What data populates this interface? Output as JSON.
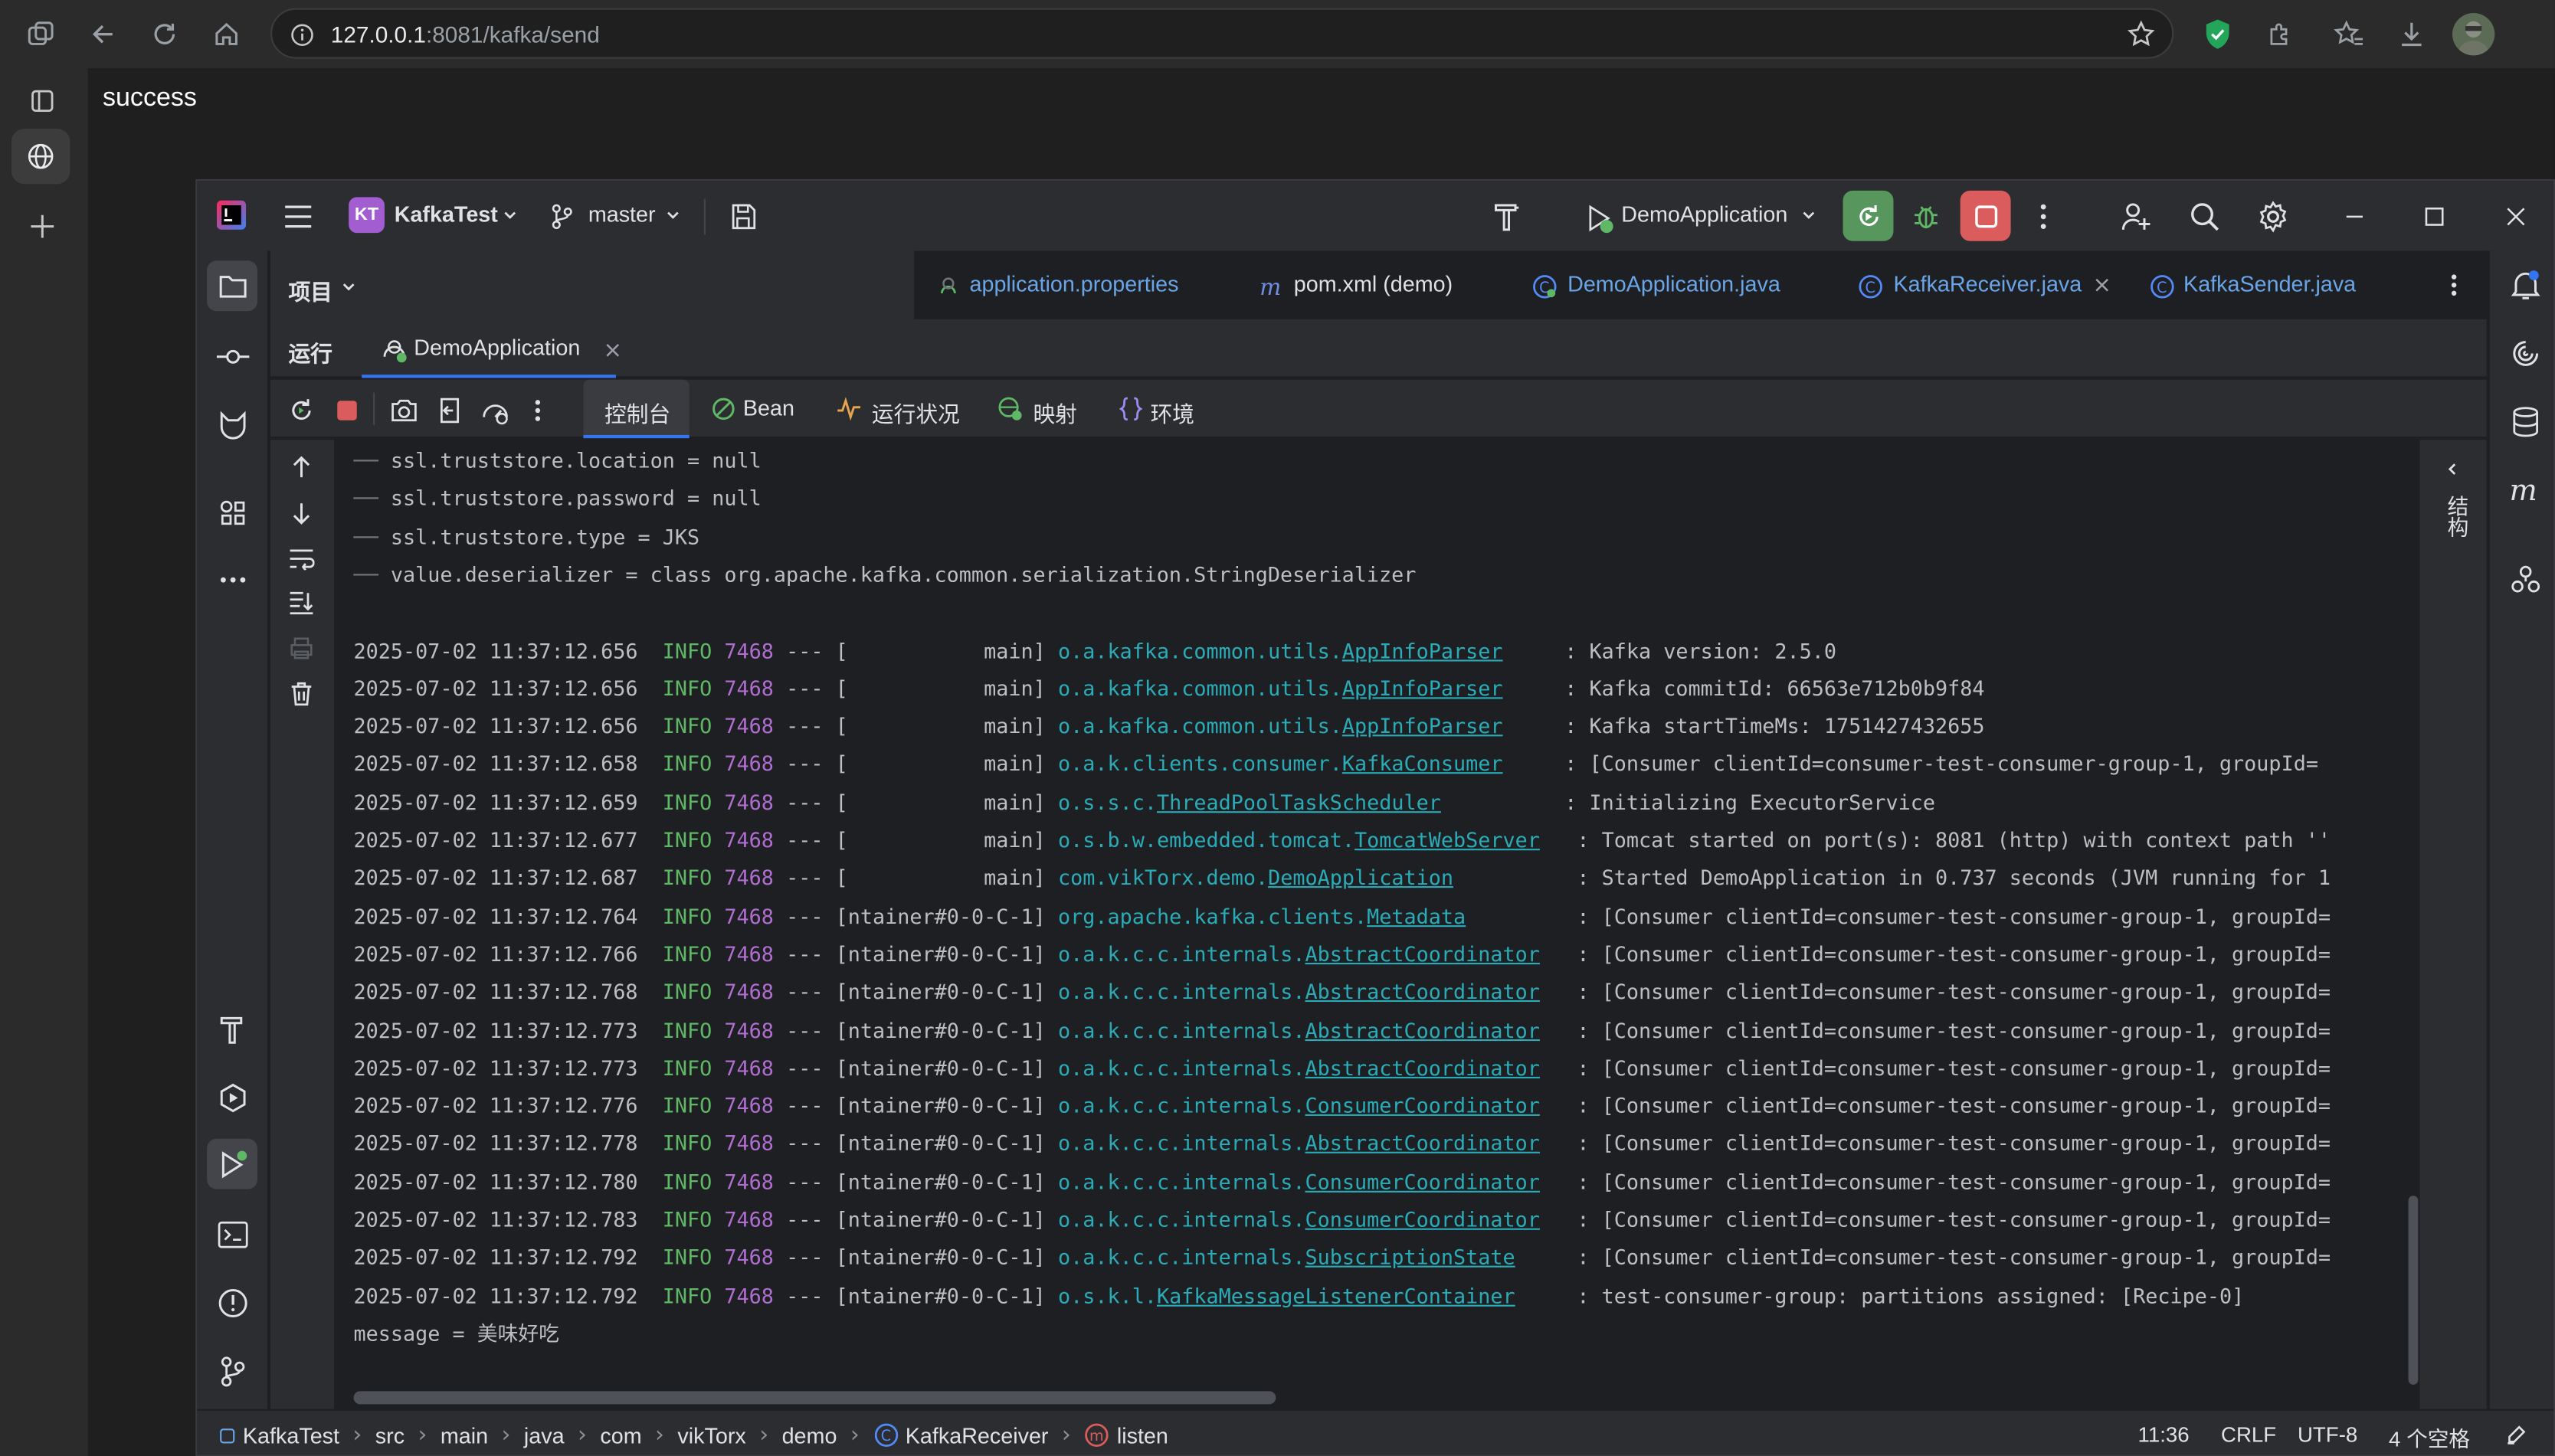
{
  "browser": {
    "url_host": "127.0.0.1",
    "url_path": ":8081/kafka/send",
    "page_text": "success"
  },
  "ide": {
    "project_badge": "KT",
    "project_name": "KafkaTest",
    "branch": "master",
    "run_config": "DemoApplication",
    "project_panel_label": "项目",
    "editor_tabs": [
      {
        "label": "application.properties"
      },
      {
        "label": "pom.xml (demo)"
      },
      {
        "label": "DemoApplication.java"
      },
      {
        "label": "KafkaReceiver.java"
      },
      {
        "label": "KafkaSender.java"
      }
    ],
    "run_label": "运行",
    "run_tab": "DemoApplication",
    "console_tabs": [
      "控制台",
      "Bean",
      "运行状况",
      "映射",
      "环境"
    ],
    "side_vertical_label": "结构",
    "console": {
      "config_lines": [
        "ssl.truststore.location = null",
        "ssl.truststore.password = null",
        "ssl.truststore.type = JKS",
        "value.deserializer = class org.apache.kafka.common.serialization.StringDeserializer"
      ],
      "log_lines": [
        {
          "ts": "2025-07-02 11:37:12.656",
          "level": "INFO",
          "pid": "7468",
          "sep": "---",
          "thread": "[           main]",
          "pkg": "o.a.kafka.common.utils.",
          "cls": "AppInfoParser",
          "pad": "    ",
          "msg": ": Kafka version: 2.5.0"
        },
        {
          "ts": "2025-07-02 11:37:12.656",
          "level": "INFO",
          "pid": "7468",
          "sep": "---",
          "thread": "[           main]",
          "pkg": "o.a.kafka.common.utils.",
          "cls": "AppInfoParser",
          "pad": "    ",
          "msg": ": Kafka commitId: 66563e712b0b9f84"
        },
        {
          "ts": "2025-07-02 11:37:12.656",
          "level": "INFO",
          "pid": "7468",
          "sep": "---",
          "thread": "[           main]",
          "pkg": "o.a.kafka.common.utils.",
          "cls": "AppInfoParser",
          "pad": "    ",
          "msg": ": Kafka startTimeMs: 1751427432655"
        },
        {
          "ts": "2025-07-02 11:37:12.658",
          "level": "INFO",
          "pid": "7468",
          "sep": "---",
          "thread": "[           main]",
          "pkg": "o.a.k.clients.consumer.",
          "cls": "KafkaConsumer",
          "pad": "    ",
          "msg": ": [Consumer clientId=consumer-test-consumer-group-1, groupId="
        },
        {
          "ts": "2025-07-02 11:37:12.659",
          "level": "INFO",
          "pid": "7468",
          "sep": "---",
          "thread": "[           main]",
          "pkg": "o.s.s.c.",
          "cls": "ThreadPoolTaskScheduler",
          "pad": "         ",
          "msg": ": Initializing ExecutorService"
        },
        {
          "ts": "2025-07-02 11:37:12.677",
          "level": "INFO",
          "pid": "7468",
          "sep": "---",
          "thread": "[           main]",
          "pkg": "o.s.b.w.embedded.tomcat.",
          "cls": "TomcatWebServer",
          "pad": "  ",
          "msg": ": Tomcat started on port(s): 8081 (http) with context path ''"
        },
        {
          "ts": "2025-07-02 11:37:12.687",
          "level": "INFO",
          "pid": "7468",
          "sep": "---",
          "thread": "[           main]",
          "pkg": "com.vikTorx.demo.",
          "cls": "DemoApplication",
          "pad": "         ",
          "msg": ": Started DemoApplication in 0.737 seconds (JVM running for 1"
        },
        {
          "ts": "2025-07-02 11:37:12.764",
          "level": "INFO",
          "pid": "7468",
          "sep": "---",
          "thread": "[ntainer#0-0-C-1]",
          "pkg": "org.apache.kafka.clients.",
          "cls": "Metadata",
          "pad": "        ",
          "msg": ": [Consumer clientId=consumer-test-consumer-group-1, groupId="
        },
        {
          "ts": "2025-07-02 11:37:12.766",
          "level": "INFO",
          "pid": "7468",
          "sep": "---",
          "thread": "[ntainer#0-0-C-1]",
          "pkg": "o.a.k.c.c.internals.",
          "cls": "AbstractCoordinator",
          "pad": "  ",
          "msg": ": [Consumer clientId=consumer-test-consumer-group-1, groupId="
        },
        {
          "ts": "2025-07-02 11:37:12.768",
          "level": "INFO",
          "pid": "7468",
          "sep": "---",
          "thread": "[ntainer#0-0-C-1]",
          "pkg": "o.a.k.c.c.internals.",
          "cls": "AbstractCoordinator",
          "pad": "  ",
          "msg": ": [Consumer clientId=consumer-test-consumer-group-1, groupId="
        },
        {
          "ts": "2025-07-02 11:37:12.773",
          "level": "INFO",
          "pid": "7468",
          "sep": "---",
          "thread": "[ntainer#0-0-C-1]",
          "pkg": "o.a.k.c.c.internals.",
          "cls": "AbstractCoordinator",
          "pad": "  ",
          "msg": ": [Consumer clientId=consumer-test-consumer-group-1, groupId="
        },
        {
          "ts": "2025-07-02 11:37:12.773",
          "level": "INFO",
          "pid": "7468",
          "sep": "---",
          "thread": "[ntainer#0-0-C-1]",
          "pkg": "o.a.k.c.c.internals.",
          "cls": "AbstractCoordinator",
          "pad": "  ",
          "msg": ": [Consumer clientId=consumer-test-consumer-group-1, groupId="
        },
        {
          "ts": "2025-07-02 11:37:12.776",
          "level": "INFO",
          "pid": "7468",
          "sep": "---",
          "thread": "[ntainer#0-0-C-1]",
          "pkg": "o.a.k.c.c.internals.",
          "cls": "ConsumerCoordinator",
          "pad": "  ",
          "msg": ": [Consumer clientId=consumer-test-consumer-group-1, groupId="
        },
        {
          "ts": "2025-07-02 11:37:12.778",
          "level": "INFO",
          "pid": "7468",
          "sep": "---",
          "thread": "[ntainer#0-0-C-1]",
          "pkg": "o.a.k.c.c.internals.",
          "cls": "AbstractCoordinator",
          "pad": "  ",
          "msg": ": [Consumer clientId=consumer-test-consumer-group-1, groupId="
        },
        {
          "ts": "2025-07-02 11:37:12.780",
          "level": "INFO",
          "pid": "7468",
          "sep": "---",
          "thread": "[ntainer#0-0-C-1]",
          "pkg": "o.a.k.c.c.internals.",
          "cls": "ConsumerCoordinator",
          "pad": "  ",
          "msg": ": [Consumer clientId=consumer-test-consumer-group-1, groupId="
        },
        {
          "ts": "2025-07-02 11:37:12.783",
          "level": "INFO",
          "pid": "7468",
          "sep": "---",
          "thread": "[ntainer#0-0-C-1]",
          "pkg": "o.a.k.c.c.internals.",
          "cls": "ConsumerCoordinator",
          "pad": "  ",
          "msg": ": [Consumer clientId=consumer-test-consumer-group-1, groupId="
        },
        {
          "ts": "2025-07-02 11:37:12.792",
          "level": "INFO",
          "pid": "7468",
          "sep": "---",
          "thread": "[ntainer#0-0-C-1]",
          "pkg": "o.a.k.c.c.internals.",
          "cls": "SubscriptionState",
          "pad": "    ",
          "msg": ": [Consumer clientId=consumer-test-consumer-group-1, groupId="
        },
        {
          "ts": "2025-07-02 11:37:12.792",
          "level": "INFO",
          "pid": "7468",
          "sep": "---",
          "thread": "[ntainer#0-0-C-1]",
          "pkg": "o.s.k.l.",
          "cls": "KafkaMessageListenerContainer",
          "pad": "    ",
          "msg": ": test-consumer-group: partitions assigned: [Recipe-0]"
        }
      ],
      "message_line": "message = 美味好吃"
    },
    "breadcrumb": [
      "KafkaTest",
      "src",
      "main",
      "java",
      "com",
      "vikTorx",
      "demo",
      "KafkaReceiver",
      "listen"
    ],
    "status": {
      "position": "11:36",
      "line_sep": "CRLF",
      "encoding": "UTF-8",
      "indent": "4 个空格"
    }
  }
}
